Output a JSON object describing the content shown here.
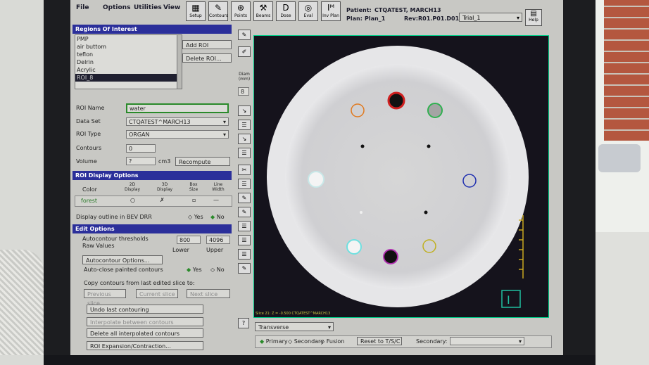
{
  "menu": [
    "File",
    "Options",
    "Utilities",
    "View"
  ],
  "toolbar": [
    {
      "label": "Setup",
      "icon": "setup-icon"
    },
    {
      "label": "Contours",
      "icon": "contours-icon"
    },
    {
      "label": "Points",
      "icon": "points-icon"
    },
    {
      "label": "Beams",
      "icon": "beams-icon"
    },
    {
      "label": "Dose",
      "icon": "dose-icon"
    },
    {
      "label": "Eval",
      "icon": "eval-icon"
    },
    {
      "label": "Inv Plan",
      "icon": "inv-plan-icon"
    }
  ],
  "patient": {
    "label": "Patient:",
    "name": "CTQATEST, MARCH13",
    "plan_label": "Plan:",
    "plan": "Plan_1",
    "rev_label": "Rev:",
    "rev": "R01.P01.D01"
  },
  "trial": "Trial_1",
  "help": "Help",
  "roi": {
    "header": "Regions Of Interest",
    "items": [
      "PMP",
      "air buttom",
      "teflon",
      "Delrin",
      "Acrylic",
      "ROI_8"
    ],
    "add": "Add ROI",
    "delete": "Delete ROI...",
    "name_label": "ROI Name",
    "name_value": "water",
    "dataset_label": "Data Set",
    "dataset_value": "CTQATEST^MARCH13",
    "type_label": "ROI Type",
    "type_value": "ORGAN",
    "contours_label": "Contours",
    "contours_value": "0",
    "volume_label": "Volume",
    "volume_value": "?",
    "volume_unit": "cm3",
    "recompute": "Recompute"
  },
  "diam": {
    "label": "Diam (mm)",
    "value": "8"
  },
  "display": {
    "header": "ROI Display Options",
    "col_color": "Color",
    "col_2d": "2D Display",
    "col_3d": "3D Display",
    "col_box": "Box Size",
    "col_line": "Line Width",
    "color_value": "forest",
    "bev_label": "Display outline in BEV DRR",
    "yes": "Yes",
    "no": "No"
  },
  "edit": {
    "header": "Edit Options",
    "autocontour_label": "Autocontour thresholds",
    "raw_label": "Raw Values",
    "lower_value": "800",
    "upper_value": "4096",
    "lower_label": "Lower",
    "upper_label": "Upper",
    "autocontour_options": "Autocontour Options...",
    "autoclose_label": "Auto-close painted contours",
    "yes": "Yes",
    "no": "No",
    "copy_label": "Copy contours from last edited slice to:",
    "previous_slice": "Previous slice",
    "current_slice": "Current slice",
    "next_slice": "Next slice",
    "undo": "Undo last contouring",
    "interpolate": "Interpolate between contours",
    "delete_interp": "Delete all interpolated contours",
    "expansion": "ROI Expansion/Contraction..."
  },
  "viewer": {
    "status": "Slice 21: Z = -0.500 CTQATEST^MARCH13",
    "orientation": "Transverse",
    "primary": "Primary",
    "secondary": "Secondary",
    "fusion": "Fusion",
    "reset": "Reset to T/S/C",
    "secondary_label": "Secondary:",
    "question": "?"
  },
  "colors": {
    "accent": "#2b2f9a",
    "viewer_border": "#00cc88"
  }
}
